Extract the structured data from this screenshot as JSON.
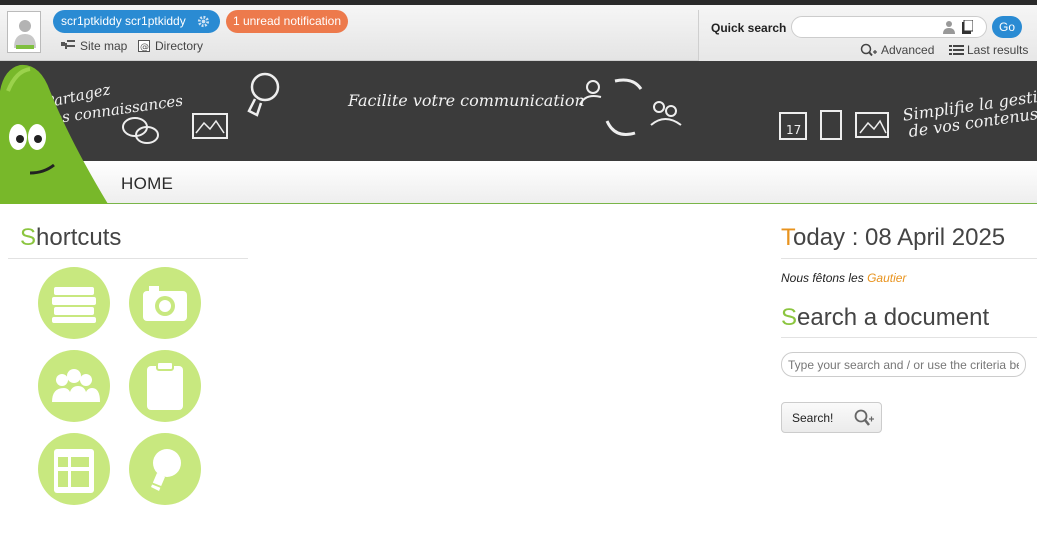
{
  "header": {
    "user_name": "scr1ptkiddy scr1ptkiddy",
    "notification": "1 unread notification",
    "links": {
      "site_map": "Site map",
      "directory": "Directory"
    }
  },
  "quick_search": {
    "label": "Quick search",
    "placeholder": "",
    "go": "Go",
    "advanced": "Advanced",
    "last_results": "Last results"
  },
  "banner": {
    "text1": "Partagez",
    "text2": "vos connaissances",
    "text3": "Facilite votre communication",
    "text4": "Simplifie la gestion",
    "text5": "de vos contenus"
  },
  "nav": {
    "home": "HOME"
  },
  "shortcuts": {
    "title_first": "S",
    "title_rest": "hortcuts",
    "items": [
      "books-icon",
      "camera-icon",
      "group-icon",
      "clipboard-icon",
      "calendar-icon",
      "lightbulb-icon"
    ]
  },
  "today": {
    "title_first": "T",
    "title_rest": "oday : 08 April 2025",
    "fete_prefix": "Nous fêtons les",
    "fete_name": "Gautier"
  },
  "doc_search": {
    "title_first": "S",
    "title_rest": "earch a document",
    "placeholder": "Type your search and / or use the criteria below",
    "button": "Search!"
  },
  "colors": {
    "accent_green": "#8bc53f",
    "accent_orange": "#e8931e",
    "blue": "#2a8bd3",
    "notif": "#ed7a4c",
    "shortcut_bg": "#c8e87f"
  }
}
